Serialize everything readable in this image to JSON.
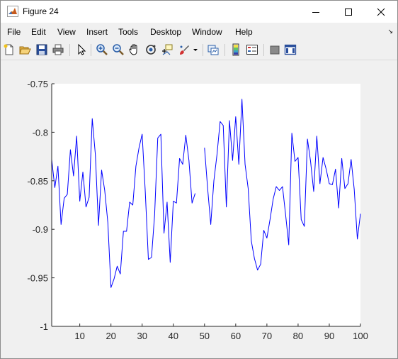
{
  "window": {
    "title": "Figure 24"
  },
  "menu": {
    "items": [
      "File",
      "Edit",
      "View",
      "Insert",
      "Tools",
      "Desktop",
      "Window",
      "Help"
    ],
    "overflow_arrow": "↘"
  },
  "toolbar": {
    "icons": [
      "new-figure-icon",
      "open-file-icon",
      "save-icon",
      "print-icon",
      "pointer-icon",
      "zoom-in-icon",
      "zoom-out-icon",
      "pan-icon",
      "rotate-3d-icon",
      "data-cursor-icon",
      "brush-icon",
      "brush-dropdown-icon",
      "link-plot-icon",
      "colorbar-icon",
      "legend-icon",
      "hide-plot-tools-icon",
      "show-plot-tools-icon"
    ]
  },
  "colors": {
    "line": "#0000ff",
    "axes_bg": "#ffffff",
    "figure_bg": "#f0f0f0"
  },
  "chart_data": {
    "type": "line",
    "title": "",
    "xlabel": "",
    "ylabel": "",
    "xlim": [
      1,
      100
    ],
    "ylim": [
      -1,
      -0.75
    ],
    "xticks": [
      10,
      20,
      30,
      40,
      50,
      60,
      70,
      80,
      90,
      100
    ],
    "xtick_labels": [
      "10",
      "20",
      "30",
      "40",
      "50",
      "60",
      "70",
      "80",
      "90",
      "100"
    ],
    "yticks": [
      -1,
      -0.95,
      -0.9,
      -0.85,
      -0.8,
      -0.75
    ],
    "ytick_labels": [
      "-1",
      "-0.95",
      "-0.9",
      "-0.85",
      "-0.8",
      "-0.75"
    ],
    "grid": false,
    "series": [
      {
        "x": [
          1,
          2,
          3,
          4,
          5,
          6,
          7,
          8,
          9,
          10,
          11,
          12,
          13,
          14,
          15,
          16,
          17,
          18,
          19,
          20,
          21,
          22,
          23,
          24,
          25,
          26,
          27,
          28,
          29,
          30,
          31,
          32,
          33,
          34,
          35,
          36,
          37,
          38,
          39,
          40,
          41,
          42,
          43,
          44,
          45,
          46,
          47,
          48,
          49,
          50,
          51,
          52,
          53,
          54,
          55,
          56,
          57,
          58,
          59,
          60,
          61,
          62,
          63,
          64,
          65,
          66,
          67,
          68,
          69,
          70,
          71,
          72,
          73,
          74,
          75,
          76,
          77,
          78,
          79,
          80,
          81,
          82,
          83,
          84,
          85,
          86,
          87,
          88,
          89,
          90,
          91,
          92,
          93,
          94,
          95,
          96,
          97,
          98,
          99,
          100
        ],
        "y": [
          -0.828,
          -0.857,
          -0.835,
          -0.895,
          -0.868,
          -0.864,
          -0.818,
          -0.845,
          -0.804,
          -0.871,
          -0.841,
          -0.877,
          -0.867,
          -0.786,
          -0.823,
          -0.896,
          -0.839,
          -0.86,
          -0.893,
          -0.96,
          -0.951,
          -0.938,
          -0.946,
          -0.902,
          -0.902,
          -0.872,
          -0.875,
          -0.835,
          -0.816,
          -0.802,
          -0.861,
          -0.931,
          -0.929,
          -0.885,
          -0.806,
          -0.802,
          -0.904,
          -0.872,
          -0.934,
          -0.871,
          -0.873,
          -0.827,
          -0.833,
          -0.803,
          -0.829,
          -0.873,
          -0.863,
          null,
          null,
          -0.816,
          -0.858,
          -0.895,
          -0.85,
          -0.823,
          -0.789,
          -0.793,
          -0.877,
          -0.788,
          -0.829,
          -0.784,
          -0.833,
          -0.766,
          -0.833,
          -0.858,
          -0.912,
          -0.93,
          -0.942,
          -0.936,
          -0.901,
          -0.909,
          -0.89,
          -0.869,
          -0.856,
          -0.86,
          -0.856,
          -0.885,
          -0.916,
          -0.801,
          -0.83,
          -0.826,
          -0.89,
          -0.897,
          -0.807,
          -0.83,
          -0.861,
          -0.804,
          -0.853,
          -0.826,
          -0.838,
          -0.853,
          -0.854,
          -0.838,
          -0.878,
          -0.827,
          -0.858,
          -0.853,
          -0.828,
          -0.859,
          -0.91,
          -0.884
        ]
      }
    ]
  }
}
